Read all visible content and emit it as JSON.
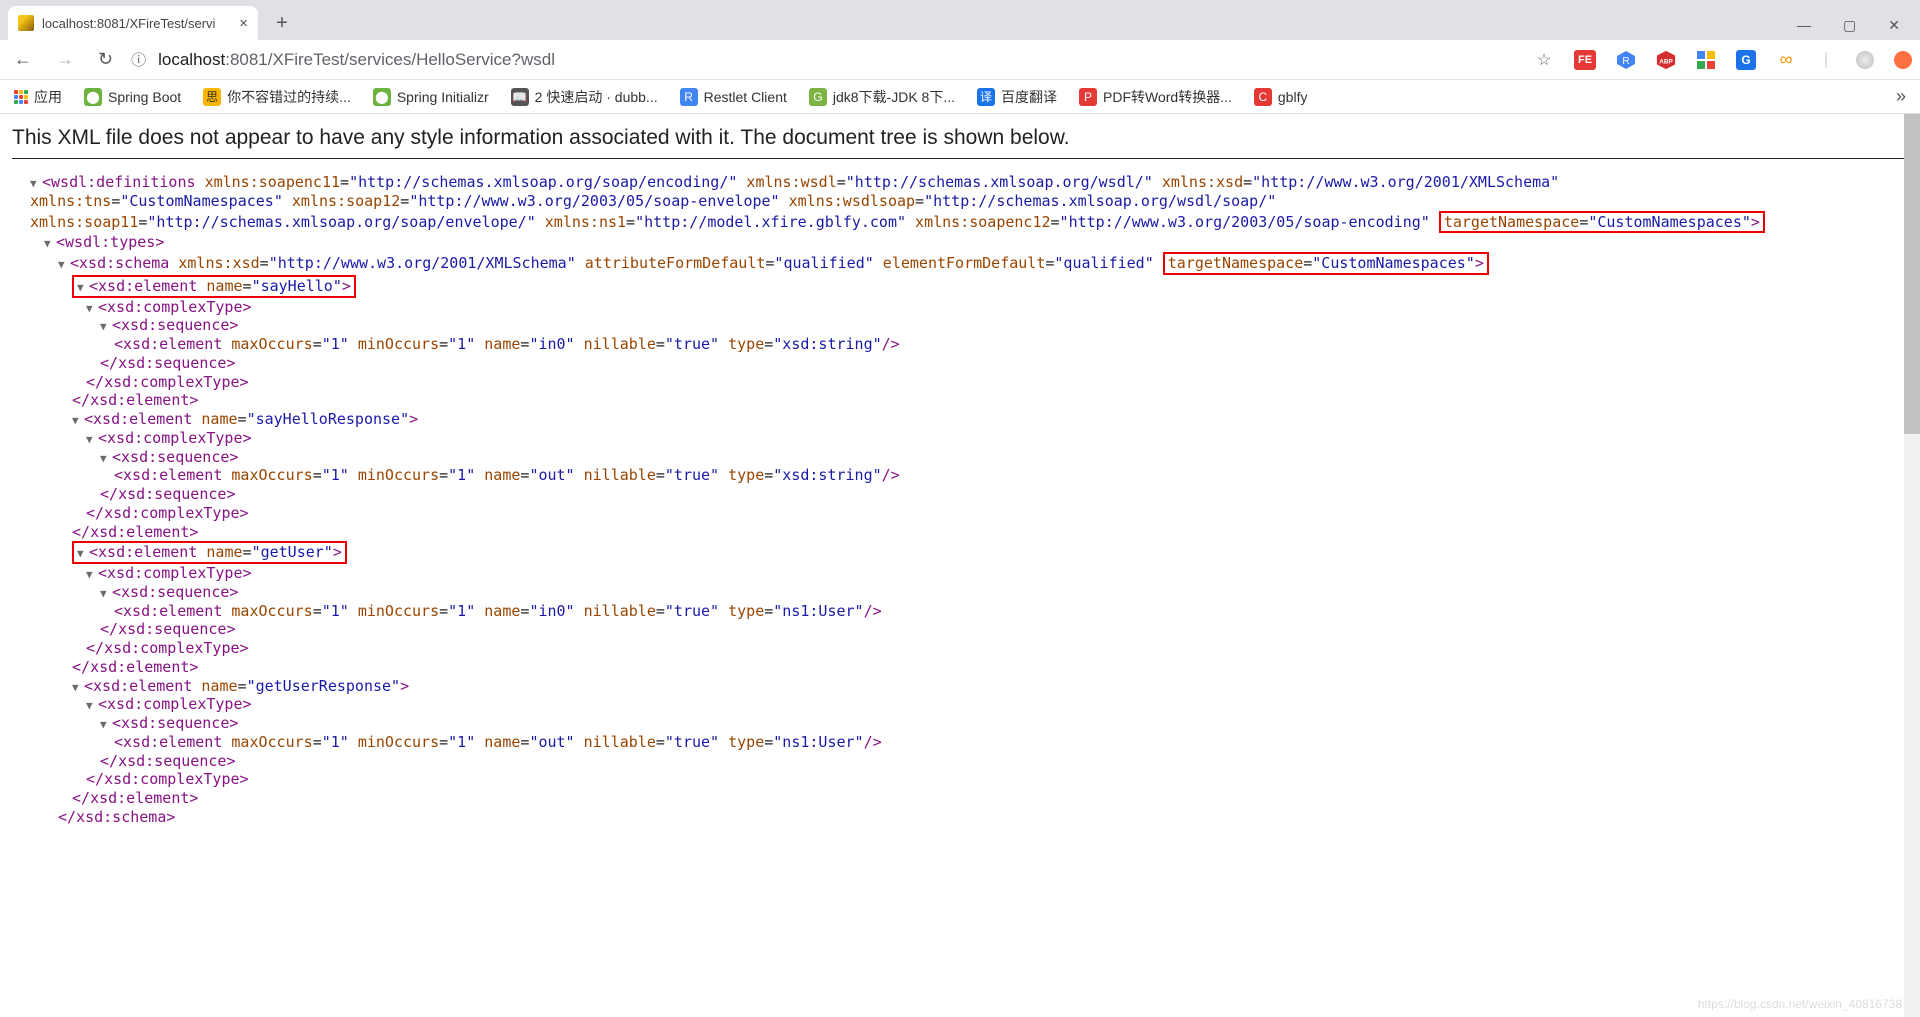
{
  "window": {
    "tab_title": "localhost:8081/XFireTest/servi",
    "minimize": "—",
    "maximize": "▢",
    "close": "✕"
  },
  "address": {
    "back": "←",
    "forward": "→",
    "reload": "↻",
    "info": "ⓘ",
    "url_host": "localhost",
    "url_port": ":8081",
    "url_path": "/XFireTest/services/HelloService?wsdl",
    "star": "☆"
  },
  "ext": {
    "fe": "FE",
    "r": "R",
    "abp": "ABP",
    "more": "»"
  },
  "bookmarks": {
    "apps": "应用",
    "spring_boot": "Spring Boot",
    "sf": "你不容错过的持续...",
    "spring_init": "Spring Initializr",
    "dubbo": "2 快速启动 · dubb...",
    "restlet": "Restlet Client",
    "jdk": "jdk8下载-JDK 8下...",
    "baidu": "百度翻译",
    "pdf": "PDF转Word转换器...",
    "gblfy": "gblfy"
  },
  "banner": "This XML file does not appear to have any style information associated with it. The document tree is shown below.",
  "xml": {
    "defs_open_1": "<wsdl:definitions xmlns:soapenc11=\"http://schemas.xmlsoap.org/soap/encoding/\" xmlns:wsdl=\"http://schemas.xmlsoap.org/wsdl/\" xmlns:xsd=\"http://www.w3.org/2001/XMLSchema\"",
    "defs_open_2": "xmlns:tns=\"CustomNamespaces\" xmlns:soap12=\"http://www.w3.org/2003/05/soap-envelope\" xmlns:wsdlsoap=\"http://schemas.xmlsoap.org/wsdl/soap/\"",
    "defs_open_3a": "xmlns:soap11=\"http://schemas.xmlsoap.org/soap/envelope/\" xmlns:ns1=\"http://model.xfire.gblfy.com\" xmlns:soapenc12=\"http://www.w3.org/2003/05/soap-encoding\"",
    "defs_open_3b": "targetNamespace=\"CustomNamespaces\">",
    "types_open": "<wsdl:types>",
    "schema_open_a": "<xsd:schema xmlns:xsd=\"http://www.w3.org/2001/XMLSchema\" attributeFormDefault=\"qualified\" elementFormDefault=\"qualified\"",
    "schema_open_b": "targetNamespace=\"CustomNamespaces\">",
    "el_sayHello": "<xsd:element name=\"sayHello\">",
    "complexType_open": "<xsd:complexType>",
    "sequence_open": "<xsd:sequence>",
    "el_in0_str": "<xsd:element maxOccurs=\"1\" minOccurs=\"1\" name=\"in0\" nillable=\"true\" type=\"xsd:string\"/>",
    "sequence_close": "</xsd:sequence>",
    "complexType_close": "</xsd:complexType>",
    "element_close": "</xsd:element>",
    "el_sayHelloResp": "<xsd:element name=\"sayHelloResponse\">",
    "el_out_str": "<xsd:element maxOccurs=\"1\" minOccurs=\"1\" name=\"out\" nillable=\"true\" type=\"xsd:string\"/>",
    "el_getUser": "<xsd:element name=\"getUser\">",
    "el_in0_user": "<xsd:element maxOccurs=\"1\" minOccurs=\"1\" name=\"in0\" nillable=\"true\" type=\"ns1:User\"/>",
    "el_getUserResp": "<xsd:element name=\"getUserResponse\">",
    "el_out_user": "<xsd:element maxOccurs=\"1\" minOccurs=\"1\" name=\"out\" nillable=\"true\" type=\"ns1:User\"/>",
    "schema_close": "</xsd:schema>"
  },
  "watermark": "https://blog.csdn.net/weixin_40816738"
}
